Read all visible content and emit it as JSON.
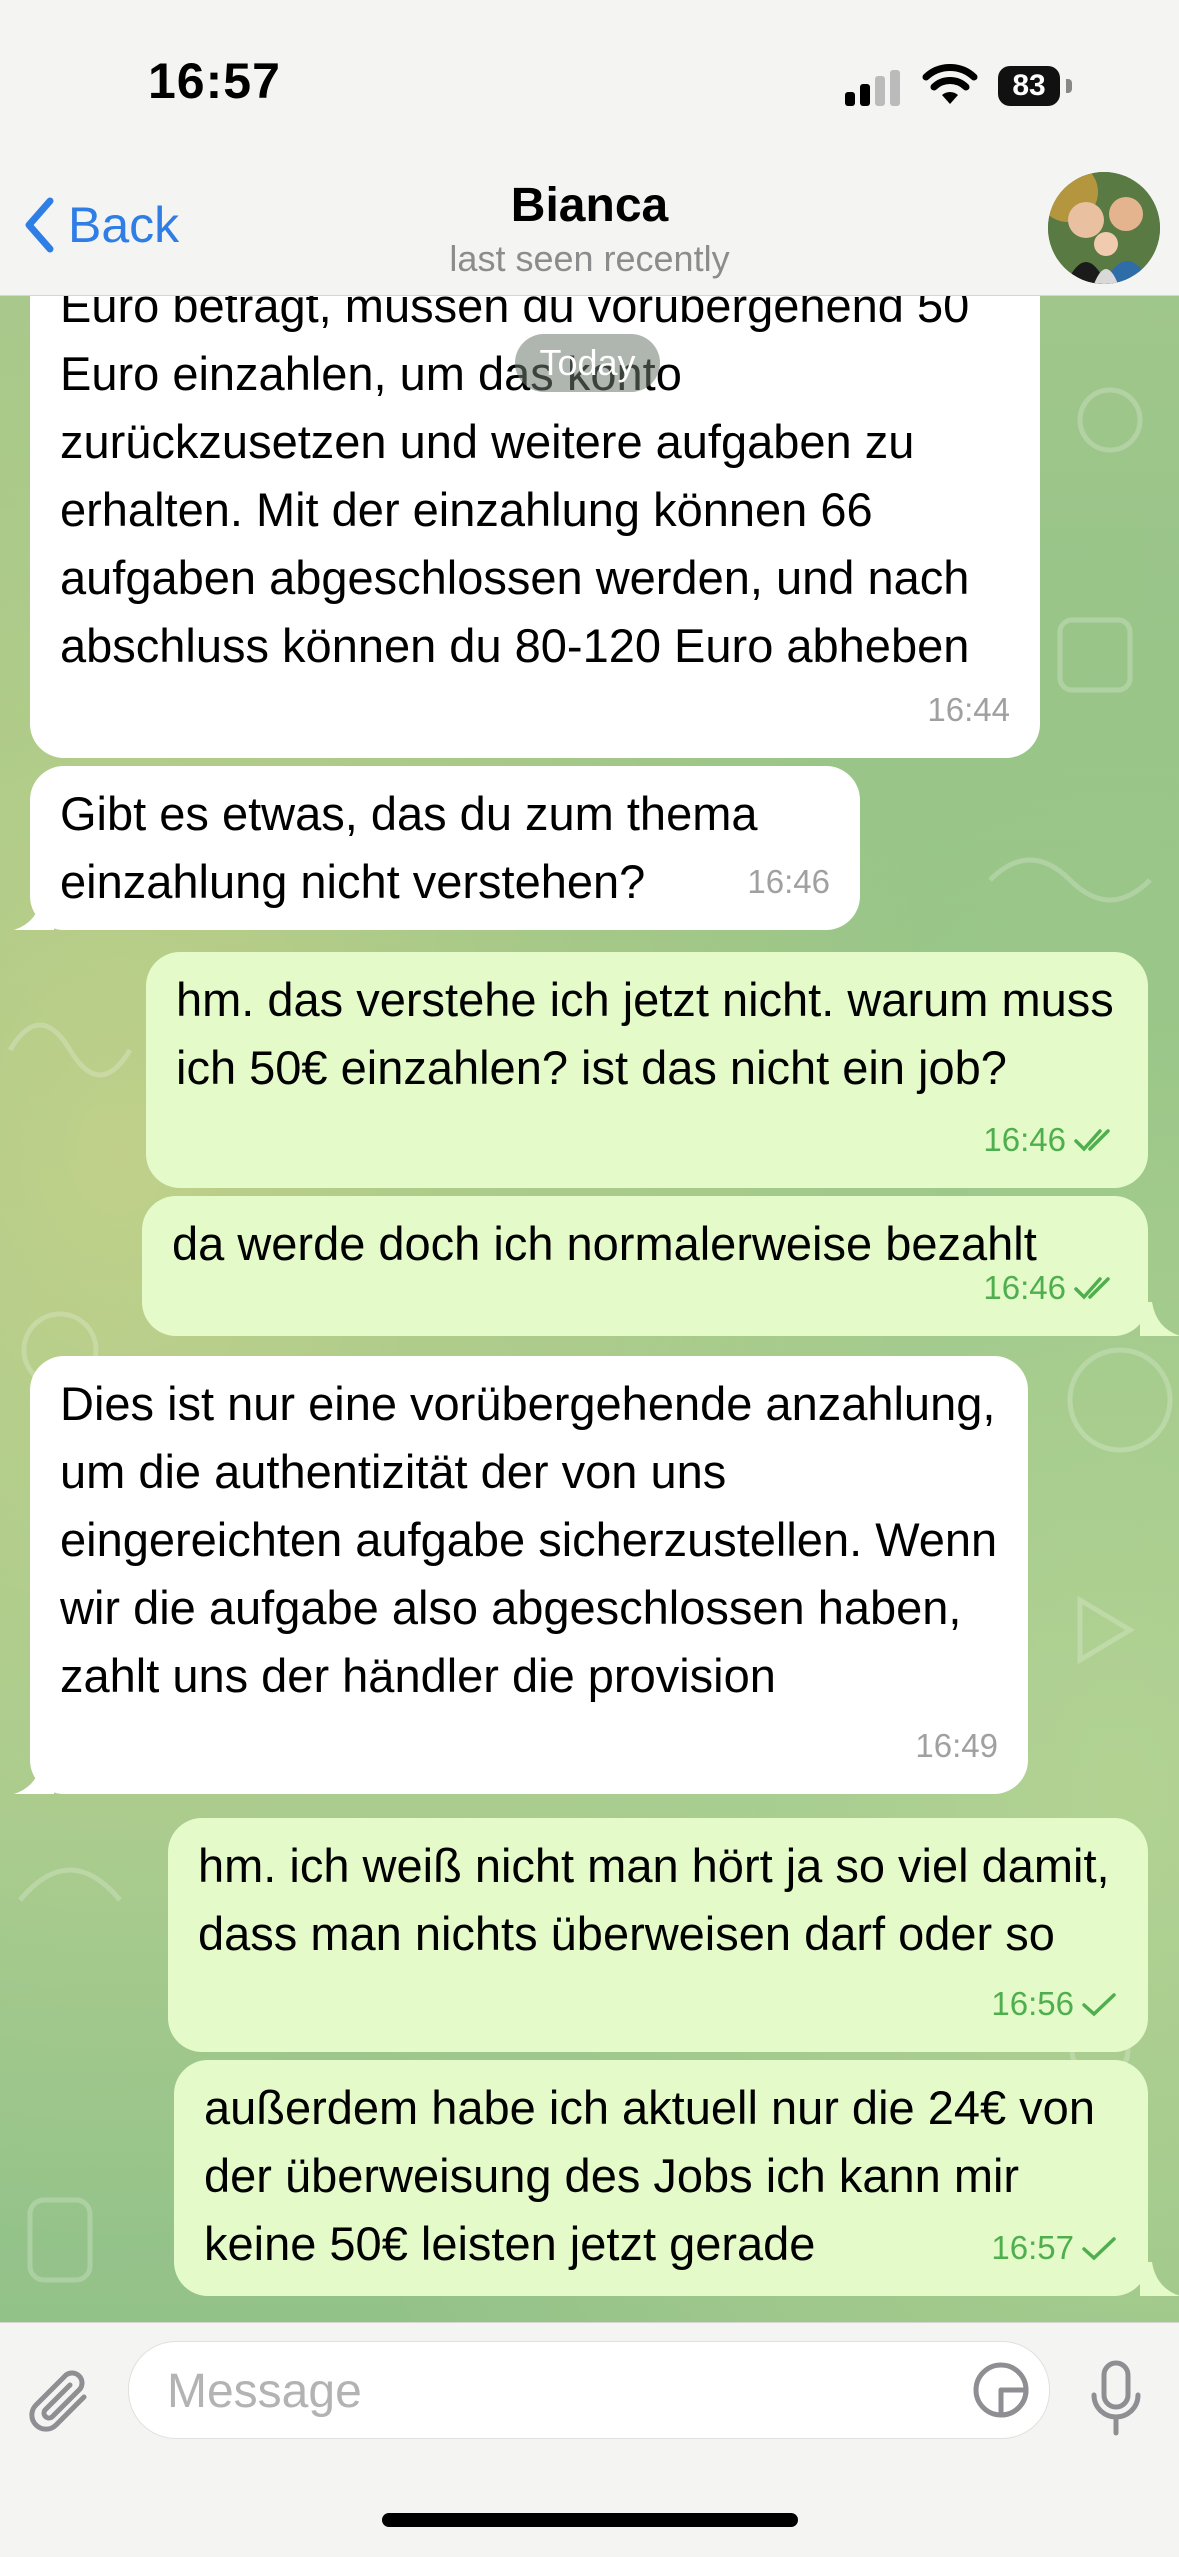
{
  "status_bar": {
    "time": "16:57",
    "battery": "83"
  },
  "header": {
    "back_label": "Back",
    "title": "Bianca",
    "subtitle": "last seen recently"
  },
  "date_pill": "Today",
  "messages": [
    {
      "dir": "in",
      "text": "Euro beträgt, müssen du vorübergehend 50 Euro einzahlen, um das konto zurückzusetzen und weitere aufgaben zu erhalten. Mit der einzahlung können 66 aufgaben abgeschlossen werden, und nach abschluss können du 80-120 Euro abheben",
      "time": "16:44"
    },
    {
      "dir": "in",
      "text": "Gibt es etwas, das du zum thema einzahlung nicht verstehen?",
      "time": "16:46"
    },
    {
      "dir": "out",
      "text": "hm. das verstehe ich jetzt nicht. warum muss ich 50€ einzahlen? ist das nicht ein job?",
      "time": "16:46",
      "status": "read"
    },
    {
      "dir": "out",
      "text": "da werde doch ich normalerweise bezahlt",
      "time": "16:46",
      "status": "read"
    },
    {
      "dir": "in",
      "text": "Dies ist nur eine vorübergehende anzahlung, um die authentizität der von uns eingereichten aufgabe sicherzustellen. Wenn wir die aufgabe also abgeschlossen haben, zahlt uns der händler die provision",
      "time": "16:49"
    },
    {
      "dir": "out",
      "text": "hm. ich weiß nicht man hört ja so viel damit, dass man nichts überweisen darf oder so",
      "time": "16:56",
      "status": "sent"
    },
    {
      "dir": "out",
      "text": "außerdem habe ich aktuell nur die 24€ von der überweisung des Jobs ich kann mir keine 50€ leisten jetzt gerade",
      "time": "16:57",
      "status": "sent"
    }
  ],
  "input": {
    "placeholder": "Message"
  },
  "colors": {
    "accent": "#2f7ee6",
    "outgoing_bubble": "#e4fbc9",
    "incoming_bubble": "#ffffff",
    "check": "#4fae4e"
  }
}
